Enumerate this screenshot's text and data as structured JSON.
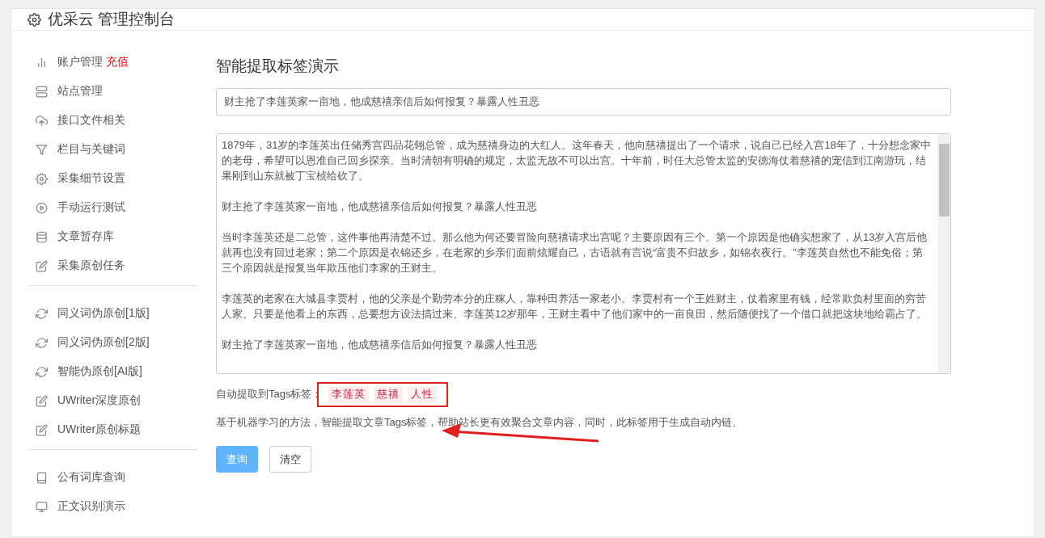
{
  "header": {
    "title": "优采云 管理控制台"
  },
  "sidebar": {
    "groups": [
      {
        "items": [
          {
            "label": "账户管理",
            "extra": "充值"
          },
          {
            "label": "站点管理"
          },
          {
            "label": "接口文件相关"
          },
          {
            "label": "栏目与关键词"
          },
          {
            "label": "采集细节设置"
          },
          {
            "label": "手动运行测试"
          },
          {
            "label": "文章暂存库"
          },
          {
            "label": "采集原创任务"
          }
        ]
      },
      {
        "items": [
          {
            "label": "同义词伪原创[1版]"
          },
          {
            "label": "同义词伪原创[2版]"
          },
          {
            "label": "智能伪原创[AI版]"
          },
          {
            "label": "UWriter深度原创"
          },
          {
            "label": "UWriter原创标题"
          }
        ]
      },
      {
        "items": [
          {
            "label": "公有词库查询"
          },
          {
            "label": "正文识别演示"
          }
        ]
      }
    ]
  },
  "main": {
    "heading": "智能提取标签演示",
    "title_value": "财主抢了李莲英家一亩地，他成慈禧亲信后如何报复？暴露人性丑恶",
    "content_paragraphs": [
      "1879年，31岁的李莲英出任储秀宫四品花翎总管，成为慈禧身边的大红人。这年春天，他向慈禧提出了一个请求，说自己已经入宫18年了，十分想念家中的老母，希望可以恩准自己回乡探亲。当时清朝有明确的规定，太监无故不可以出宫。十年前，时任大总管太监的安德海仗着慈禧的宠信到江南游玩，结果刚到山东就被丁宝桢给砍了。",
      "财主抢了李莲英家一亩地，他成慈禧亲信后如何报复？暴露人性丑恶",
      "当时李莲英还是二总管，这件事他再清楚不过。那么他为何还要冒险向慈禧请求出宫呢？主要原因有三个。第一个原因是他确实想家了，从13岁入宫后他就再也没有回过老家；第二个原因是衣锦还乡，在老家的乡亲们面前炫耀自己，古语就有言说“富贵不归故乡，如锦衣夜行。”李莲英自然也不能免俗；第三个原因就是报复当年欺压他们李家的王财主。",
      "李莲英的老家在大城县李贾村，他的父亲是个勤劳本分的庄稼人，靠种田养活一家老小。李贾村有一个王姓财主，仗着家里有钱，经常欺负村里面的穷苦人家。只要是他看上的东西，总要想方设法搞过来。李莲英12岁那年，王财主看中了他们家中的一亩良田，然后随便找了一个借口就把这块地给霸占了。",
      "财主抢了李莲英家一亩地，他成慈禧亲信后如何报复？暴露人性丑恶"
    ],
    "tags_label": "自动提取到Tags标签：",
    "tags": [
      "李莲英",
      "慈禧",
      "人性"
    ],
    "description": "基于机器学习的方法，智能提取文章Tags标签，帮助站长更有效聚合文章内容，同时，此标签用于生成自动内链。",
    "buttons": [
      {
        "label": "查询",
        "kind": "primary"
      },
      {
        "label": "清空",
        "kind": "default"
      }
    ]
  }
}
